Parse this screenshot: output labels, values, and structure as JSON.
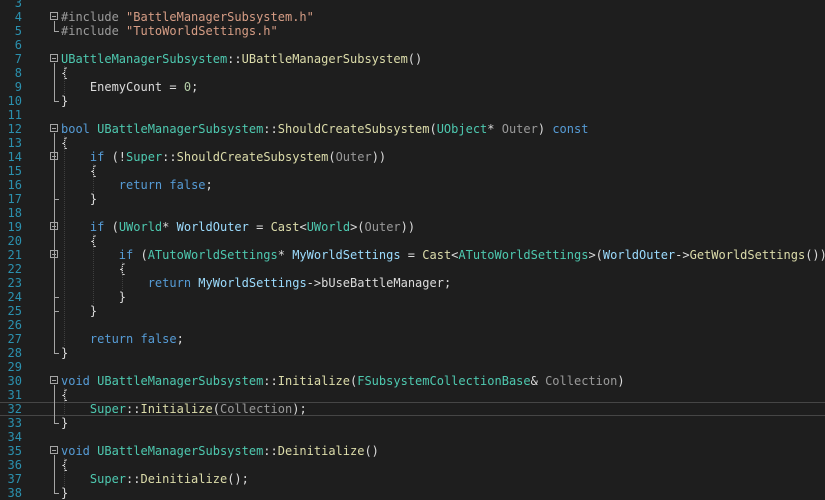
{
  "editor": {
    "colors": {
      "background": "#1e1e1e",
      "line_number": "#2b91af",
      "keyword": "#569cd6",
      "type": "#4ec9b0",
      "string": "#d69d85",
      "number": "#b5cea8",
      "function": "#dcdcaa",
      "default": "#dcdcdc"
    },
    "lines": [
      {
        "n": "3",
        "tokens": []
      },
      {
        "n": "4",
        "tokens": [
          {
            "t": "#include ",
            "c": "pp"
          },
          {
            "t": "\"BattleManagerSubsystem.h\"",
            "c": "str"
          }
        ]
      },
      {
        "n": "5",
        "tokens": [
          {
            "t": "#include ",
            "c": "pp"
          },
          {
            "t": "\"TutoWorldSettings.h\"",
            "c": "str"
          }
        ]
      },
      {
        "n": "6",
        "tokens": []
      },
      {
        "n": "7",
        "tokens": [
          {
            "t": "UBattleManagerSubsystem",
            "c": "type"
          },
          {
            "t": "::",
            "c": "default"
          },
          {
            "t": "UBattleManagerSubsystem",
            "c": "fn"
          },
          {
            "t": "()",
            "c": "default"
          }
        ]
      },
      {
        "n": "8",
        "tokens": [
          {
            "t": "{",
            "c": "default"
          }
        ]
      },
      {
        "n": "9",
        "tokens": [
          {
            "t": "    EnemyCount = ",
            "c": "default"
          },
          {
            "t": "0",
            "c": "num"
          },
          {
            "t": ";",
            "c": "default"
          }
        ]
      },
      {
        "n": "10",
        "tokens": [
          {
            "t": "}",
            "c": "default"
          }
        ]
      },
      {
        "n": "11",
        "tokens": []
      },
      {
        "n": "12",
        "tokens": [
          {
            "t": "bool ",
            "c": "kw"
          },
          {
            "t": "UBattleManagerSubsystem",
            "c": "type"
          },
          {
            "t": "::",
            "c": "default"
          },
          {
            "t": "ShouldCreateSubsystem",
            "c": "fn"
          },
          {
            "t": "(",
            "c": "default"
          },
          {
            "t": "UObject",
            "c": "type"
          },
          {
            "t": "* ",
            "c": "default"
          },
          {
            "t": "Outer",
            "c": "param"
          },
          {
            "t": ") ",
            "c": "default"
          },
          {
            "t": "const",
            "c": "kw"
          }
        ]
      },
      {
        "n": "13",
        "tokens": [
          {
            "t": "{",
            "c": "default"
          }
        ]
      },
      {
        "n": "14",
        "tokens": [
          {
            "t": "    ",
            "c": "default"
          },
          {
            "t": "if",
            "c": "kw"
          },
          {
            "t": " (!",
            "c": "default"
          },
          {
            "t": "Super",
            "c": "type"
          },
          {
            "t": "::",
            "c": "default"
          },
          {
            "t": "ShouldCreateSubsystem",
            "c": "fn"
          },
          {
            "t": "(",
            "c": "default"
          },
          {
            "t": "Outer",
            "c": "param"
          },
          {
            "t": "))",
            "c": "default"
          }
        ]
      },
      {
        "n": "15",
        "tokens": [
          {
            "t": "    {",
            "c": "default"
          }
        ]
      },
      {
        "n": "16",
        "tokens": [
          {
            "t": "        ",
            "c": "default"
          },
          {
            "t": "return",
            "c": "kw"
          },
          {
            "t": " ",
            "c": "default"
          },
          {
            "t": "false",
            "c": "kw"
          },
          {
            "t": ";",
            "c": "default"
          }
        ]
      },
      {
        "n": "17",
        "tokens": [
          {
            "t": "    }",
            "c": "default"
          }
        ]
      },
      {
        "n": "18",
        "tokens": []
      },
      {
        "n": "19",
        "tokens": [
          {
            "t": "    ",
            "c": "default"
          },
          {
            "t": "if",
            "c": "kw"
          },
          {
            "t": " (",
            "c": "default"
          },
          {
            "t": "UWorld",
            "c": "type"
          },
          {
            "t": "* ",
            "c": "default"
          },
          {
            "t": "WorldOuter",
            "c": "var"
          },
          {
            "t": " = ",
            "c": "default"
          },
          {
            "t": "Cast",
            "c": "fn"
          },
          {
            "t": "<",
            "c": "default"
          },
          {
            "t": "UWorld",
            "c": "type"
          },
          {
            "t": ">(",
            "c": "default"
          },
          {
            "t": "Outer",
            "c": "param"
          },
          {
            "t": "))",
            "c": "default"
          }
        ]
      },
      {
        "n": "20",
        "tokens": [
          {
            "t": "    {",
            "c": "default"
          }
        ]
      },
      {
        "n": "21",
        "tokens": [
          {
            "t": "        ",
            "c": "default"
          },
          {
            "t": "if",
            "c": "kw"
          },
          {
            "t": " (",
            "c": "default"
          },
          {
            "t": "ATutoWorldSettings",
            "c": "type"
          },
          {
            "t": "* ",
            "c": "default"
          },
          {
            "t": "MyWorldSettings",
            "c": "var"
          },
          {
            "t": " = ",
            "c": "default"
          },
          {
            "t": "Cast",
            "c": "fn"
          },
          {
            "t": "<",
            "c": "default"
          },
          {
            "t": "ATutoWorldSettings",
            "c": "type"
          },
          {
            "t": ">(",
            "c": "default"
          },
          {
            "t": "WorldOuter",
            "c": "var"
          },
          {
            "t": "->",
            "c": "default"
          },
          {
            "t": "GetWorldSettings",
            "c": "fn"
          },
          {
            "t": "()))",
            "c": "default"
          }
        ]
      },
      {
        "n": "22",
        "tokens": [
          {
            "t": "        {",
            "c": "default"
          }
        ]
      },
      {
        "n": "23",
        "tokens": [
          {
            "t": "            ",
            "c": "default"
          },
          {
            "t": "return",
            "c": "kw"
          },
          {
            "t": " ",
            "c": "default"
          },
          {
            "t": "MyWorldSettings",
            "c": "var"
          },
          {
            "t": "->bUseBattleManager;",
            "c": "default"
          }
        ]
      },
      {
        "n": "24",
        "tokens": [
          {
            "t": "        }",
            "c": "default"
          }
        ]
      },
      {
        "n": "25",
        "tokens": [
          {
            "t": "    }",
            "c": "default"
          }
        ]
      },
      {
        "n": "26",
        "tokens": []
      },
      {
        "n": "27",
        "tokens": [
          {
            "t": "    ",
            "c": "default"
          },
          {
            "t": "return",
            "c": "kw"
          },
          {
            "t": " ",
            "c": "default"
          },
          {
            "t": "false",
            "c": "kw"
          },
          {
            "t": ";",
            "c": "default"
          }
        ]
      },
      {
        "n": "28",
        "tokens": [
          {
            "t": "}",
            "c": "default"
          }
        ]
      },
      {
        "n": "29",
        "tokens": []
      },
      {
        "n": "30",
        "tokens": [
          {
            "t": "void ",
            "c": "kw"
          },
          {
            "t": "UBattleManagerSubsystem",
            "c": "type"
          },
          {
            "t": "::",
            "c": "default"
          },
          {
            "t": "Initialize",
            "c": "fn"
          },
          {
            "t": "(",
            "c": "default"
          },
          {
            "t": "FSubsystemCollectionBase",
            "c": "type"
          },
          {
            "t": "& ",
            "c": "default"
          },
          {
            "t": "Collection",
            "c": "param"
          },
          {
            "t": ")",
            "c": "default"
          }
        ]
      },
      {
        "n": "31",
        "tokens": [
          {
            "t": "{",
            "c": "default"
          }
        ]
      },
      {
        "n": "32",
        "tokens": [
          {
            "t": "    ",
            "c": "default"
          },
          {
            "t": "Super",
            "c": "type"
          },
          {
            "t": "::",
            "c": "default"
          },
          {
            "t": "Initialize",
            "c": "fn"
          },
          {
            "t": "(",
            "c": "default"
          },
          {
            "t": "Collection",
            "c": "param"
          },
          {
            "t": ");",
            "c": "default"
          }
        ]
      },
      {
        "n": "33",
        "tokens": [
          {
            "t": "}",
            "c": "default"
          }
        ]
      },
      {
        "n": "34",
        "tokens": []
      },
      {
        "n": "35",
        "tokens": [
          {
            "t": "void ",
            "c": "kw"
          },
          {
            "t": "UBattleManagerSubsystem",
            "c": "type"
          },
          {
            "t": "::",
            "c": "default"
          },
          {
            "t": "Deinitialize",
            "c": "fn"
          },
          {
            "t": "()",
            "c": "default"
          }
        ]
      },
      {
        "n": "36",
        "tokens": [
          {
            "t": "{",
            "c": "default"
          }
        ]
      },
      {
        "n": "37",
        "tokens": [
          {
            "t": "    ",
            "c": "default"
          },
          {
            "t": "Super",
            "c": "type"
          },
          {
            "t": "::",
            "c": "default"
          },
          {
            "t": "Deinitialize",
            "c": "fn"
          },
          {
            "t": "();",
            "c": "default"
          }
        ]
      },
      {
        "n": "38",
        "tokens": [
          {
            "t": "}",
            "c": "default"
          }
        ]
      }
    ]
  }
}
